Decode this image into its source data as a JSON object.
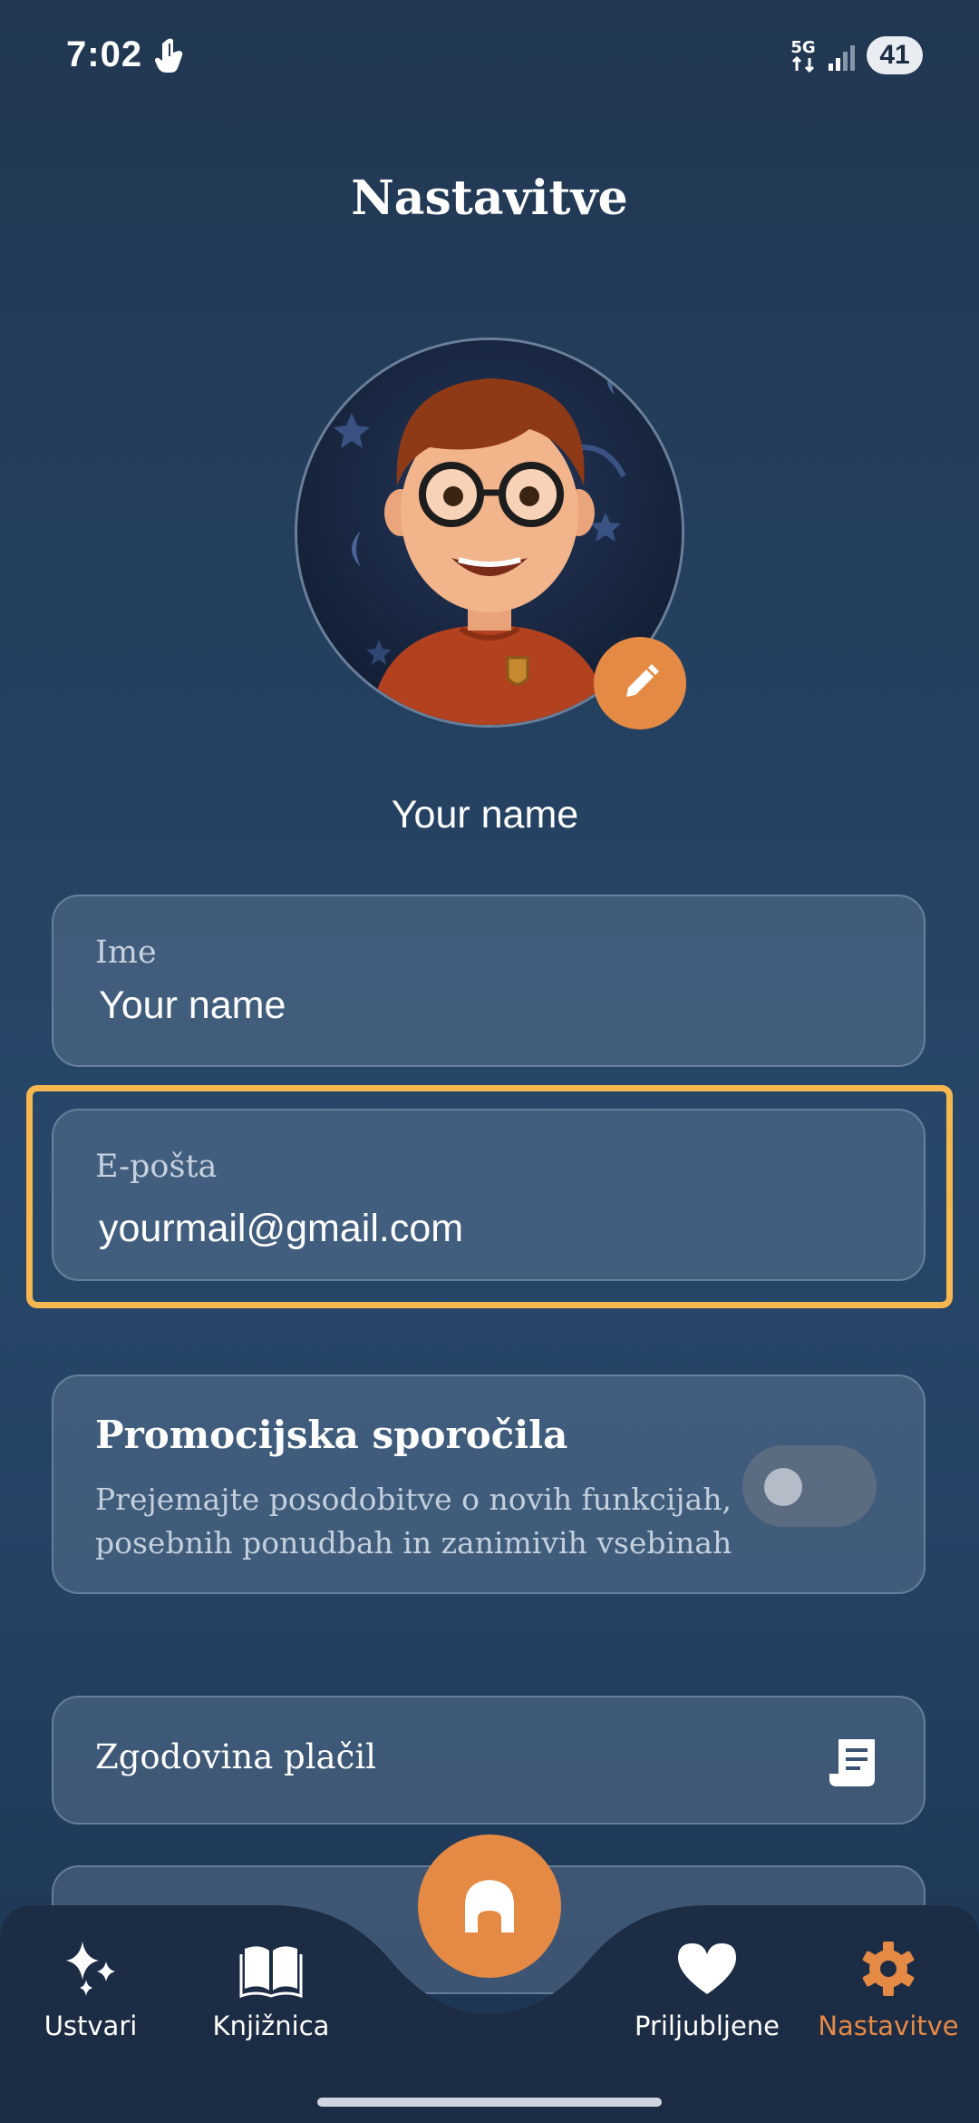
{
  "status_bar": {
    "time": "7:02",
    "network": "5G",
    "battery": "41"
  },
  "page": {
    "title": "Nastavitve",
    "profile_name": "Your name"
  },
  "form": {
    "name_label": "Ime",
    "name_value": "Your name",
    "email_label": "E-pošta",
    "email_value": "yourmail@gmail.com"
  },
  "promo": {
    "title": "Promocijska sporočila",
    "description": "Prejemajte posodobitve o novih funkcijah, posebnih ponudbah in zanimivih vsebinah",
    "enabled": false
  },
  "links": {
    "payment_history": "Zgodovina plačil"
  },
  "nav": {
    "items": [
      {
        "label": "Ustvari",
        "icon": "sparkles-icon"
      },
      {
        "label": "Knjižnica",
        "icon": "open-book-icon"
      },
      {
        "label": "Priljubljene",
        "icon": "heart-icon"
      },
      {
        "label": "Nastavitve",
        "icon": "gear-icon"
      }
    ],
    "home_icon": "castle-icon",
    "active_item": "Nastavitve"
  },
  "colors": {
    "accent": "#e58a45",
    "highlight": "#f6b650",
    "background": "#27476a"
  }
}
